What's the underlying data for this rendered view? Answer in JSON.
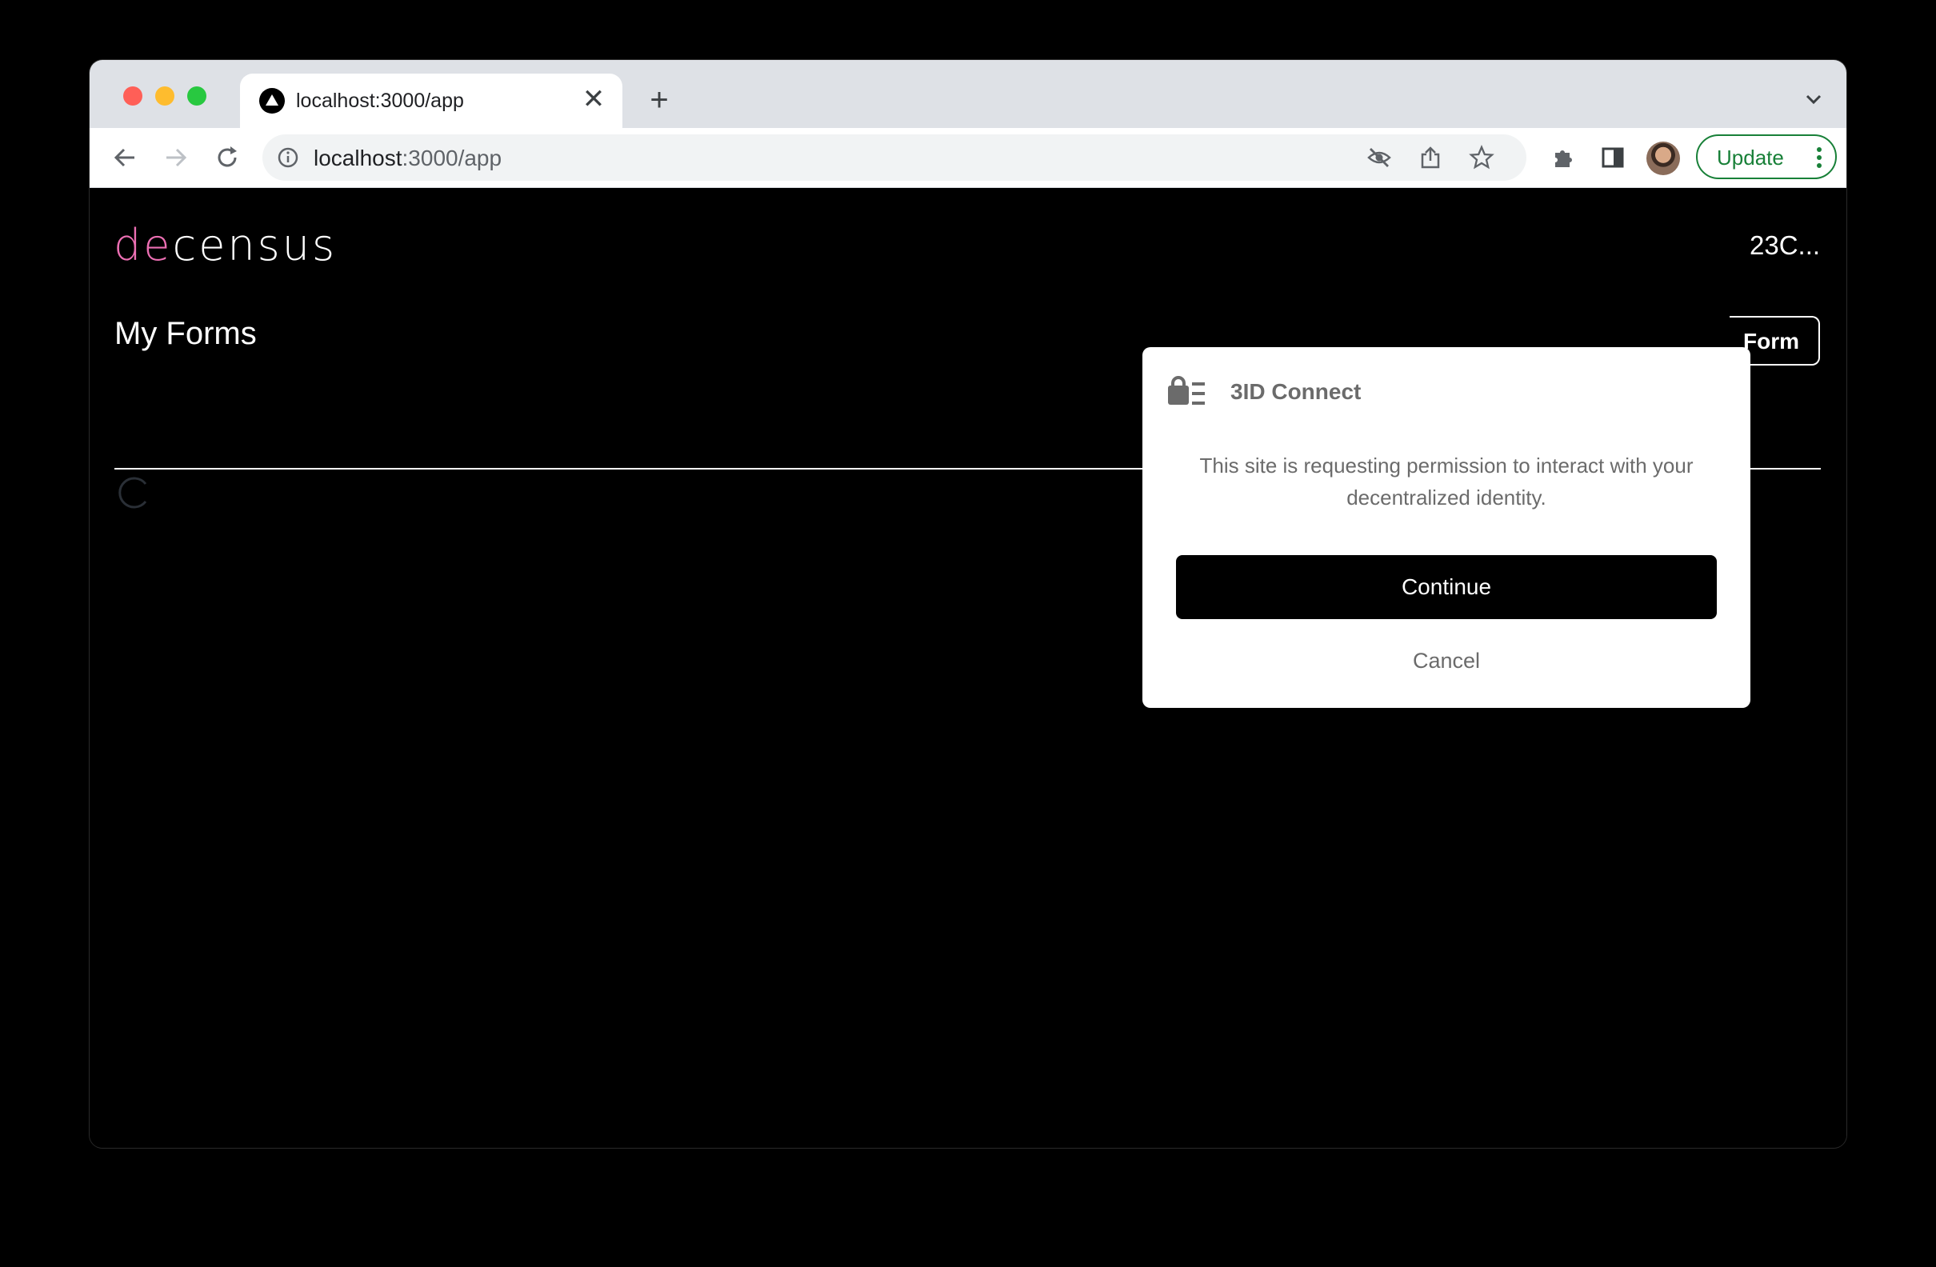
{
  "browser": {
    "tab": {
      "title": "localhost:3000/app",
      "close": "✕"
    },
    "new_tab": "+",
    "address": {
      "host": "localhost",
      "path": ":3000/app"
    },
    "update_label": "Update"
  },
  "page": {
    "logo": {
      "accent": "de",
      "rest": "census"
    },
    "title": "My Forms",
    "account": "23C...",
    "new_form_label": "Form"
  },
  "modal": {
    "title": "3ID Connect",
    "message": "This site is requesting permission to interact with your decentralized identity.",
    "continue_label": "Continue",
    "cancel_label": "Cancel"
  },
  "colors": {
    "logo_accent": "#ec6fb3",
    "update_green": "#188038",
    "modal_text": "#6b6b6b"
  }
}
